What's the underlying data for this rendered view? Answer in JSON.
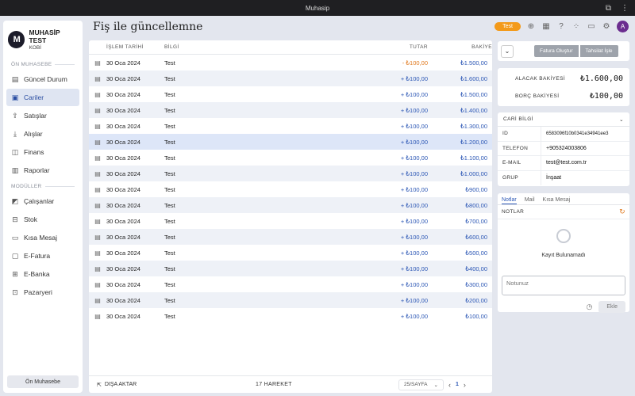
{
  "window": {
    "title": "Muhasip"
  },
  "brand": {
    "logo": "M",
    "name": "MUHASİP TEST",
    "plan": "KOBİ"
  },
  "sidebar": {
    "section1": "ÖN MUHASEBE",
    "items1": [
      {
        "label": "Güncel Durum",
        "icon": "dashboard-icon"
      },
      {
        "label": "Cariler",
        "icon": "briefcase-icon"
      },
      {
        "label": "Satışlar",
        "icon": "export-icon"
      },
      {
        "label": "Alışlar",
        "icon": "import-icon"
      },
      {
        "label": "Finans",
        "icon": "wallet-icon"
      },
      {
        "label": "Raporlar",
        "icon": "chart-icon"
      }
    ],
    "section2": "MODÜLLER",
    "items2": [
      {
        "label": "Çalışanlar",
        "icon": "employee-icon"
      },
      {
        "label": "Stok",
        "icon": "truck-icon"
      },
      {
        "label": "Kısa Mesaj",
        "icon": "message-icon"
      },
      {
        "label": "E-Fatura",
        "icon": "invoice-icon"
      },
      {
        "label": "E-Banka",
        "icon": "bank-icon"
      },
      {
        "label": "Pazaryeri",
        "icon": "store-icon"
      }
    ],
    "footer": "Ön Muhasebe"
  },
  "header": {
    "title": "Fiş ile güncellemne",
    "badge": "Test",
    "avatar": "A"
  },
  "table": {
    "headers": {
      "date": "İŞLEM TARİHİ",
      "info": "BİLGİ",
      "amount": "TUTAR",
      "balance": "BAKİYE"
    },
    "rows": [
      {
        "date": "30 Oca 2024",
        "info": "Test",
        "amount": "- ₺100,00",
        "balance": "₺1.500,00"
      },
      {
        "date": "30 Oca 2024",
        "info": "Test",
        "amount": "+ ₺100,00",
        "balance": "₺1.600,00"
      },
      {
        "date": "30 Oca 2024",
        "info": "Test",
        "amount": "+ ₺100,00",
        "balance": "₺1.500,00"
      },
      {
        "date": "30 Oca 2024",
        "info": "Test",
        "amount": "+ ₺100,00",
        "balance": "₺1.400,00"
      },
      {
        "date": "30 Oca 2024",
        "info": "Test",
        "amount": "+ ₺100,00",
        "balance": "₺1.300,00"
      },
      {
        "date": "30 Oca 2024",
        "info": "Test",
        "amount": "+ ₺100,00",
        "balance": "₺1.200,00"
      },
      {
        "date": "30 Oca 2024",
        "info": "Test",
        "amount": "+ ₺100,00",
        "balance": "₺1.100,00"
      },
      {
        "date": "30 Oca 2024",
        "info": "Test",
        "amount": "+ ₺100,00",
        "balance": "₺1.000,00"
      },
      {
        "date": "30 Oca 2024",
        "info": "Test",
        "amount": "+ ₺100,00",
        "balance": "₺900,00"
      },
      {
        "date": "30 Oca 2024",
        "info": "Test",
        "amount": "+ ₺100,00",
        "balance": "₺800,00"
      },
      {
        "date": "30 Oca 2024",
        "info": "Test",
        "amount": "+ ₺100,00",
        "balance": "₺700,00"
      },
      {
        "date": "30 Oca 2024",
        "info": "Test",
        "amount": "+ ₺100,00",
        "balance": "₺600,00"
      },
      {
        "date": "30 Oca 2024",
        "info": "Test",
        "amount": "+ ₺100,00",
        "balance": "₺500,00"
      },
      {
        "date": "30 Oca 2024",
        "info": "Test",
        "amount": "+ ₺100,00",
        "balance": "₺400,00"
      },
      {
        "date": "30 Oca 2024",
        "info": "Test",
        "amount": "+ ₺100,00",
        "balance": "₺300,00"
      },
      {
        "date": "30 Oca 2024",
        "info": "Test",
        "amount": "+ ₺100,00",
        "balance": "₺200,00"
      },
      {
        "date": "30 Oca 2024",
        "info": "Test",
        "amount": "+ ₺100,00",
        "balance": "₺100,00"
      }
    ],
    "footer": {
      "export": "DIŞA AKTAR",
      "count": "17 HAREKET",
      "per_page": "25/SAYFA",
      "page": "1"
    }
  },
  "actions": {
    "invoice": "Fatura Oluştur",
    "collect": "Tahsilat İşle"
  },
  "balances": {
    "receivable_label": "ALACAK BAKİYESİ",
    "receivable": "₺1.600,00",
    "payable_label": "BORÇ BAKİYESİ",
    "payable": "₺100,00"
  },
  "info": {
    "title": "CARİ BİLGİ",
    "rows": [
      {
        "key": "ID",
        "value": "6583096f10b0341e34941ee3"
      },
      {
        "key": "TELEFON",
        "value": "+905324003806"
      },
      {
        "key": "E-MAIL",
        "value": "test@test.com.tr"
      },
      {
        "key": "GRUP",
        "value": "İnşaat"
      }
    ]
  },
  "notes": {
    "tabs": [
      "Notlar",
      "Mail",
      "Kısa Mesaj"
    ],
    "heading": "NOTLAR",
    "empty": "Kayıt Bulunamadı",
    "placeholder": "Notunuz",
    "add": "Ekle"
  },
  "colors": {
    "accent": "#2c57b5",
    "badge": "#f39a1a",
    "avatar": "#6b2d8f",
    "negative": "#e0791e"
  }
}
